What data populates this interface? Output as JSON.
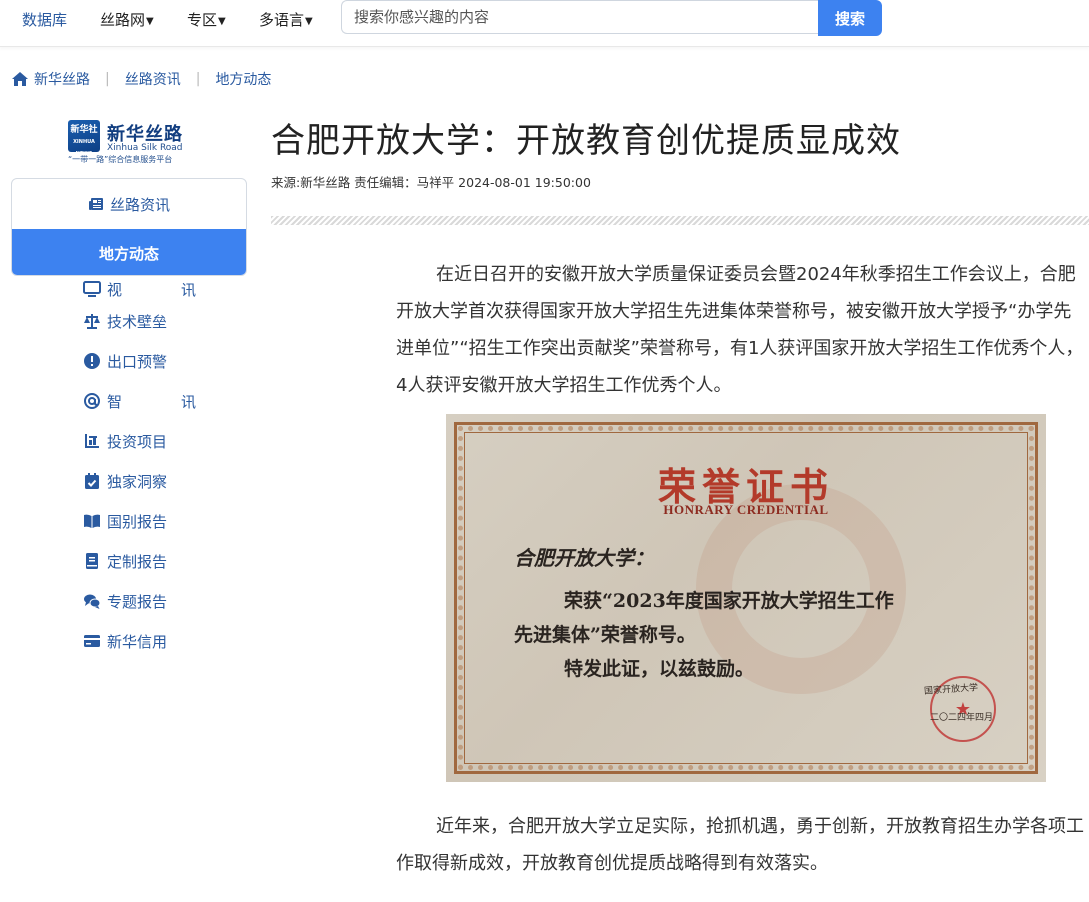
{
  "nav": {
    "items": [
      {
        "label": "数据库",
        "caret": false
      },
      {
        "label": "丝路网",
        "caret": true
      },
      {
        "label": "专区",
        "caret": true
      },
      {
        "label": "多语言",
        "caret": true
      }
    ],
    "search_placeholder": "搜索你感兴趣的内容",
    "search_button": "搜索"
  },
  "breadcrumb": [
    "丝路资讯",
    "地方动态"
  ],
  "breadcrumb_home": "新华丝路",
  "logo": {
    "mark": "新华社",
    "mark_sub": "XINHUA NEWS",
    "name": "新华丝路",
    "en": "Xinhua Silk Road",
    "slogan": "“一带一路”综合信息服务平台"
  },
  "sidebar": {
    "top": "丝路资讯",
    "active": "地方动态",
    "items": [
      {
        "label": "视　讯",
        "icon": "monitor-icon"
      },
      {
        "label": "技术壁垒",
        "icon": "scale-icon"
      },
      {
        "label": "出口预警",
        "icon": "alert-icon"
      },
      {
        "label": "智　讯",
        "icon": "at-icon"
      },
      {
        "label": "投资项目",
        "icon": "chart-icon"
      },
      {
        "label": "独家洞察",
        "icon": "calendar-check-icon"
      },
      {
        "label": "国别报告",
        "icon": "book-open-icon"
      },
      {
        "label": "定制报告",
        "icon": "book-icon"
      },
      {
        "label": "专题报告",
        "icon": "comments-icon"
      },
      {
        "label": "新华信用",
        "icon": "credit-card-icon"
      }
    ]
  },
  "article": {
    "title": "合肥开放大学：开放教育创优提质显成效",
    "meta": "来源:新华丝路 责任编辑：马祥平 2024-08-01 19:50:00",
    "p1": "在近日召开的安徽开放大学质量保证委员会暨2024年秋季招生工作会议上，合肥开放大学首次获得国家开放大学招生先进集体荣誉称号，被安徽开放大学授予“办学先进单位”“招生工作突出贡献奖”荣誉称号，有1人获评国家开放大学招生工作优秀个人，4人获评安徽开放大学招生工作优秀个人。",
    "p2": "近年来，合肥开放大学立足实际，抢抓机遇，勇于创新，开放教育招生办学各项工作取得新成效，开放教育创优提质战略得到有效落实。",
    "certificate": {
      "title": "荣誉证书",
      "subtitle": "HONRARY CREDENTIAL",
      "line1": "合肥开放大学：",
      "line2": "荣获“2023年度国家开放大学招生工作",
      "line3": "先进集体”荣誉称号。",
      "line4": "特发此证，以兹鼓励。",
      "seal": "国家开放大学",
      "date": "二〇二四年四月"
    }
  },
  "colors": {
    "accent": "#3d82f0",
    "link": "#2a5aa0"
  }
}
